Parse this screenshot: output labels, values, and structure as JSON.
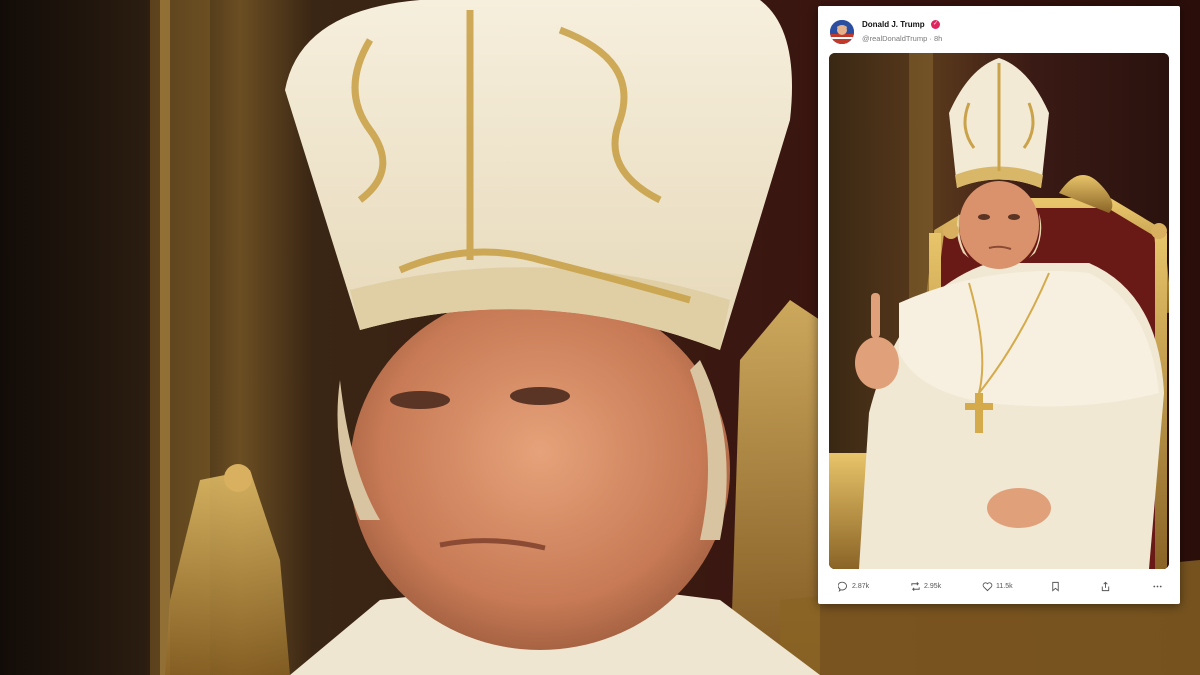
{
  "post": {
    "author_name": "Donald J. Trump",
    "handle": "@realDonaldTrump",
    "separator": "·",
    "time_ago": "8h",
    "actions": {
      "replies": "2.87k",
      "retruths": "2.95k",
      "likes": "11.5k"
    }
  },
  "icons": {
    "reply": "reply-icon",
    "retruth": "retruth-icon",
    "like": "heart-icon",
    "bookmark": "bookmark-icon",
    "share": "share-icon",
    "more": "more-icon",
    "verified": "verified-badge-icon"
  },
  "colors": {
    "badge": "#e0245e",
    "card_bg": "#ffffff",
    "muted_text": "#7a7a7a"
  }
}
